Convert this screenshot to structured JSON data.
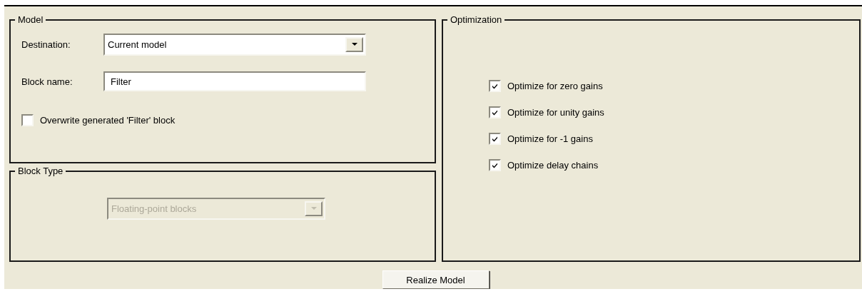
{
  "model": {
    "title": "Model",
    "destination": {
      "label": "Destination:",
      "value": "Current model"
    },
    "block_name": {
      "label": "Block name:",
      "value": "Filter"
    },
    "overwrite": {
      "label": "Overwrite generated 'Filter' block",
      "checked": false
    }
  },
  "block_type": {
    "title": "Block Type",
    "dropdown": {
      "value": "Floating-point blocks",
      "disabled": true
    }
  },
  "optimization": {
    "title": "Optimization",
    "options": [
      {
        "label": "Optimize for zero gains",
        "checked": true
      },
      {
        "label": "Optimize for unity gains",
        "checked": true
      },
      {
        "label": "Optimize for -1 gains",
        "checked": true
      },
      {
        "label": "Optimize delay chains",
        "checked": true
      }
    ]
  },
  "button": "Realize Model"
}
